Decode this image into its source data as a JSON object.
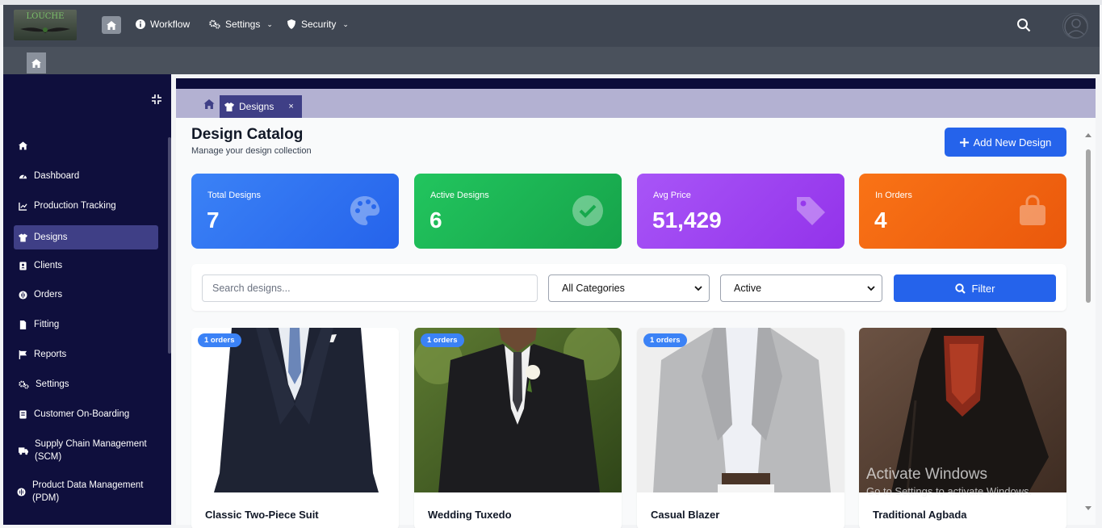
{
  "topbar": {
    "logo_text": "LOUCHE",
    "nav": [
      {
        "label": "Workflow",
        "icon": "info-circle-icon"
      },
      {
        "label": "Settings",
        "icon": "gears-icon"
      },
      {
        "label": "Security",
        "icon": "shield-icon"
      }
    ]
  },
  "sidebar": {
    "items": [
      {
        "label": "Dashboard"
      },
      {
        "label": "Production Tracking"
      },
      {
        "label": "Designs"
      },
      {
        "label": "Clients"
      },
      {
        "label": "Orders"
      },
      {
        "label": "Fitting"
      },
      {
        "label": "Reports"
      },
      {
        "label": "Settings"
      },
      {
        "label": "Customer On-Boarding"
      },
      {
        "label": "Supply Chain Management (SCM)"
      },
      {
        "label": "Product Data Management (PDM)"
      }
    ]
  },
  "tabs": {
    "active_label": "Designs",
    "close": "×"
  },
  "header": {
    "title": "Design Catalog",
    "subtitle": "Manage your design collection",
    "add_button": "Add New Design"
  },
  "stats": [
    {
      "label": "Total Designs",
      "value": "7",
      "color": "#2563eb"
    },
    {
      "label": "Active Designs",
      "value": "6",
      "color": "#16a34a"
    },
    {
      "label": "Avg Price",
      "value": "51,429",
      "color": "#9333ea"
    },
    {
      "label": "In Orders",
      "value": "4",
      "color": "#ea580c"
    }
  ],
  "filters": {
    "search_placeholder": "Search designs...",
    "category": "All Categories",
    "status": "Active",
    "button": "Filter"
  },
  "designs": [
    {
      "name": "Classic Two-Piece Suit",
      "badge": "1 orders"
    },
    {
      "name": "Wedding Tuxedo",
      "badge": "1 orders"
    },
    {
      "name": "Casual Blazer",
      "badge": "1 orders"
    },
    {
      "name": "Traditional Agbada",
      "badge": ""
    }
  ],
  "watermark": {
    "line1": "Activate Windows",
    "line2": "Go to Settings to activate Windows."
  }
}
